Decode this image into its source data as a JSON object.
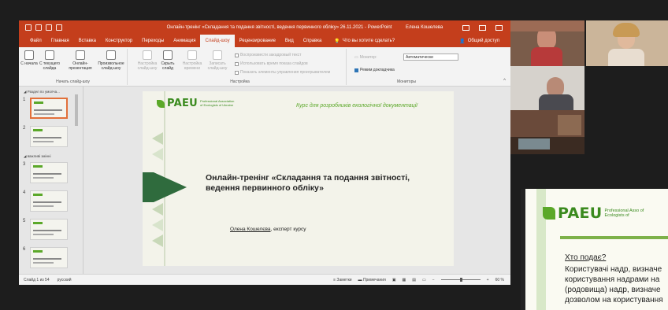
{
  "titlebar": {
    "doc_title": "Онлайн-тренінг «Складання та подання звітності, ведення первинного обліку» 26.11.2021  -  PowerPoint",
    "user": "Елена Кошелева"
  },
  "tabs": [
    "Файл",
    "Главная",
    "Вставка",
    "Конструктор",
    "Переходы",
    "Анимация",
    "Слайд-шоу",
    "Рецензирование",
    "Вид",
    "Справка"
  ],
  "tell_me": "Что вы хотите сделать?",
  "share": "Общий доступ",
  "ribbon": {
    "start_group": {
      "label": "Начать слайд-шоу",
      "buttons": [
        "С начала",
        "С текущего слайда",
        "Онлайн-презентация",
        "Произвольное слайд-шоу"
      ]
    },
    "setup_group": {
      "label": "Настройка",
      "buttons": [
        "Настройка слайд-шоу",
        "Скрыть слайд",
        "Настройка времени",
        "Записать слайд-шоу"
      ],
      "checks": [
        "Воспроизвести закадровый текст",
        "Использовать время показа слайдов",
        "Показать элементы управления проигрывателем"
      ]
    },
    "monitors_group": {
      "label": "Мониторы",
      "monitor_label": "Монитор:",
      "monitor_value": "Автоматически",
      "presenter_view": "Режим докладчика"
    }
  },
  "thumbnails": {
    "sections": [
      "Раздел по умолча...",
      "важливі змінні"
    ],
    "slide_numbers": [
      "1",
      "2",
      "3",
      "4",
      "5",
      "6"
    ]
  },
  "slide": {
    "logo": "PAEU",
    "logo_sub": "Professional Association of Ecologists of Ukraine",
    "course": "Курс для розробників екологічної документації",
    "title": "Онлайн-тренінг «Складання та подання звітності, ведення первинного обліку»",
    "author_name": "Олена Кошелєва",
    "author_rest": ", експерт курсу"
  },
  "statusbar": {
    "slide_info": "Слайд 1 из 54",
    "language": "русский",
    "notes": "Заметки",
    "comments": "Примечания",
    "zoom": "60 %"
  },
  "shared_slide": {
    "logo": "PAEU",
    "logo_sub": "Professional Asso of Ecologists of",
    "heading": "Хто подає?",
    "lines": [
      "Користувачі надр, визначе",
      "користування надрами на",
      "(родовища) надр, визначе",
      "дозволом на користування"
    ]
  },
  "colors": {
    "accent": "#c43e1c",
    "green": "#5ba829",
    "dark_green": "#2f6b3d"
  }
}
